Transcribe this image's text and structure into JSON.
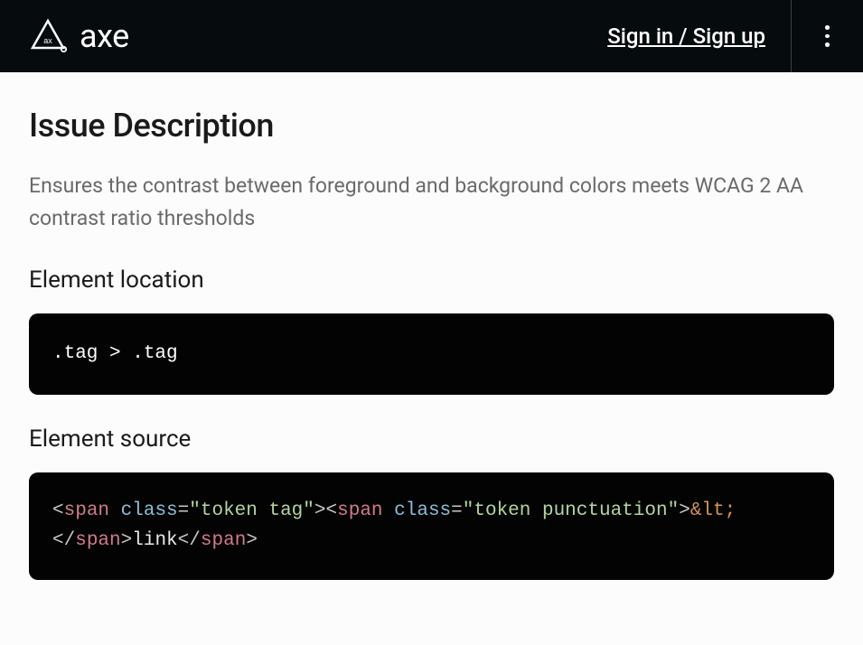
{
  "header": {
    "logo_text": "axe",
    "signin_label": "Sign in / Sign up"
  },
  "page": {
    "title": "Issue Description",
    "description": "Ensures the contrast between foreground and background colors meets WCAG 2 AA contrast ratio thresholds"
  },
  "sections": {
    "location": {
      "title": "Element location",
      "code": ".tag > .tag"
    },
    "source": {
      "title": "Element source",
      "tokens": {
        "br1": "<",
        "tag1": "span",
        "sp1": " ",
        "attr1": "class",
        "eq1": "=",
        "str1": "\"token tag\"",
        "br2": ">",
        "br3": "<",
        "tag2": "span",
        "sp2": " ",
        "attr2": "class",
        "eq2": "=",
        "str2": "\"token punctuation\"",
        "br4": ">",
        "entity": "&lt;",
        "br5": "</",
        "tag3": "span",
        "br6": ">",
        "text": "link",
        "br7": "</",
        "tag4": "span",
        "br8": ">"
      }
    }
  }
}
